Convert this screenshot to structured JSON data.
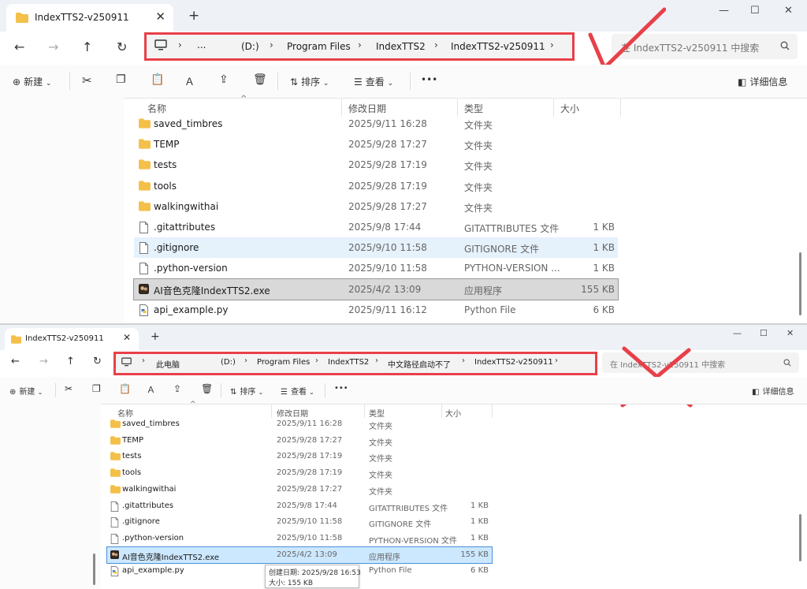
{
  "colors": {
    "red_annotation": "#e84049",
    "folder": "#f4c04a",
    "hover_row": "#e5f1fb",
    "selected_row": "#cce8ff"
  },
  "top": {
    "tab_title": "IndexTTS2-v250911",
    "breadcrumb": [
      "...",
      "(D:)",
      "Program Files",
      "IndexTTS2",
      "IndexTTS2-v250911"
    ],
    "search_placeholder": "在 IndexTTS2-v250911 中搜索",
    "annotation": "check-mark",
    "cmd": {
      "new": "新建",
      "sort": "排序",
      "view": "查看",
      "more": "•••",
      "details": "详细信息"
    },
    "columns": {
      "name": "名称",
      "date": "修改日期",
      "type": "类型",
      "size": "大小"
    },
    "rows": [
      {
        "name": "saved_timbres",
        "date": "2025/9/11 16:28",
        "type": "文件夹",
        "size": "",
        "icon": "folder-icon"
      },
      {
        "name": "TEMP",
        "date": "2025/9/28 17:27",
        "type": "文件夹",
        "size": "",
        "icon": "folder-icon"
      },
      {
        "name": "tests",
        "date": "2025/9/28 17:19",
        "type": "文件夹",
        "size": "",
        "icon": "folder-icon"
      },
      {
        "name": "tools",
        "date": "2025/9/28 17:19",
        "type": "文件夹",
        "size": "",
        "icon": "folder-icon"
      },
      {
        "name": "walkingwithai",
        "date": "2025/9/28 17:27",
        "type": "文件夹",
        "size": "",
        "icon": "folder-icon"
      },
      {
        "name": ".gitattributes",
        "date": "2025/9/8 17:44",
        "type": "GITATTRIBUTES 文件",
        "size": "1 KB",
        "icon": "file-icon"
      },
      {
        "name": ".gitignore",
        "date": "2025/9/10 11:58",
        "type": "GITIGNORE 文件",
        "size": "1 KB",
        "icon": "file-icon"
      },
      {
        "name": ".python-version",
        "date": "2025/9/10 11:58",
        "type": "PYTHON-VERSION ...",
        "size": "1 KB",
        "icon": "file-icon"
      },
      {
        "name": "AI音色克隆IndexTTS2.exe",
        "date": "2025/4/2 13:09",
        "type": "应用程序",
        "size": "155 KB",
        "icon": "exe-icon"
      },
      {
        "name": "api_example.py",
        "date": "2025/9/11 16:12",
        "type": "Python File",
        "size": "6 KB",
        "icon": "python-file-icon"
      }
    ]
  },
  "bottom": {
    "tab_title": "IndexTTS2-v250911",
    "breadcrumb": [
      "此电脑",
      "(D:)",
      "Program Files",
      "IndexTTS2",
      "中文路径启动不了",
      "IndexTTS2-v250911"
    ],
    "search_placeholder": "在 IndexTTS2-v250911 中搜索",
    "annotation": "cross-mark",
    "cmd": {
      "new": "新建",
      "sort": "排序",
      "view": "查看",
      "more": "•••",
      "details": "详细信息"
    },
    "columns": {
      "name": "名称",
      "date": "修改日期",
      "type": "类型",
      "size": "大小"
    },
    "rows": [
      {
        "name": "saved_timbres",
        "date": "2025/9/11 16:28",
        "type": "文件夹",
        "size": "",
        "icon": "folder-icon"
      },
      {
        "name": "TEMP",
        "date": "2025/9/28 17:27",
        "type": "文件夹",
        "size": "",
        "icon": "folder-icon"
      },
      {
        "name": "tests",
        "date": "2025/9/28 17:19",
        "type": "文件夹",
        "size": "",
        "icon": "folder-icon"
      },
      {
        "name": "tools",
        "date": "2025/9/28 17:19",
        "type": "文件夹",
        "size": "",
        "icon": "folder-icon"
      },
      {
        "name": "walkingwithai",
        "date": "2025/9/28 17:27",
        "type": "文件夹",
        "size": "",
        "icon": "folder-icon"
      },
      {
        "name": ".gitattributes",
        "date": "2025/9/8 17:44",
        "type": "GITATTRIBUTES 文件",
        "size": "1 KB",
        "icon": "file-icon"
      },
      {
        "name": ".gitignore",
        "date": "2025/9/10 11:58",
        "type": "GITIGNORE 文件",
        "size": "1 KB",
        "icon": "file-icon"
      },
      {
        "name": ".python-version",
        "date": "2025/9/10 11:58",
        "type": "PYTHON-VERSION 文件",
        "size": "1 KB",
        "icon": "file-icon"
      },
      {
        "name": "AI音色克隆IndexTTS2.exe",
        "date": "2025/4/2 13:09",
        "type": "应用程序",
        "size": "155 KB",
        "icon": "exe-icon"
      },
      {
        "name": "api_example.py",
        "date": "",
        "type": "Python File",
        "size": "6 KB",
        "icon": "python-file-icon"
      }
    ],
    "tooltip": {
      "created": "创建日期: 2025/9/28 16:53",
      "size": "大小: 155 KB"
    }
  }
}
